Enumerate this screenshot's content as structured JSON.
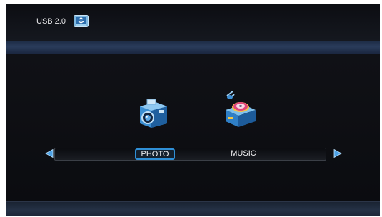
{
  "device": {
    "usb_label": "USB 2.0",
    "usb_icon": "usb-drive-icon"
  },
  "menu": {
    "items": [
      {
        "label": "PHOTO",
        "icon": "camera-icon",
        "selected": true
      },
      {
        "label": "MUSIC",
        "icon": "music-box-icon",
        "selected": false
      }
    ],
    "prev_icon": "left-arrow-icon",
    "next_icon": "right-arrow-icon"
  },
  "colors": {
    "background": "#0f1014",
    "header_band": "#2a3c5b",
    "selection": "#2f8fd6",
    "arrow": "#4fa3e6"
  }
}
